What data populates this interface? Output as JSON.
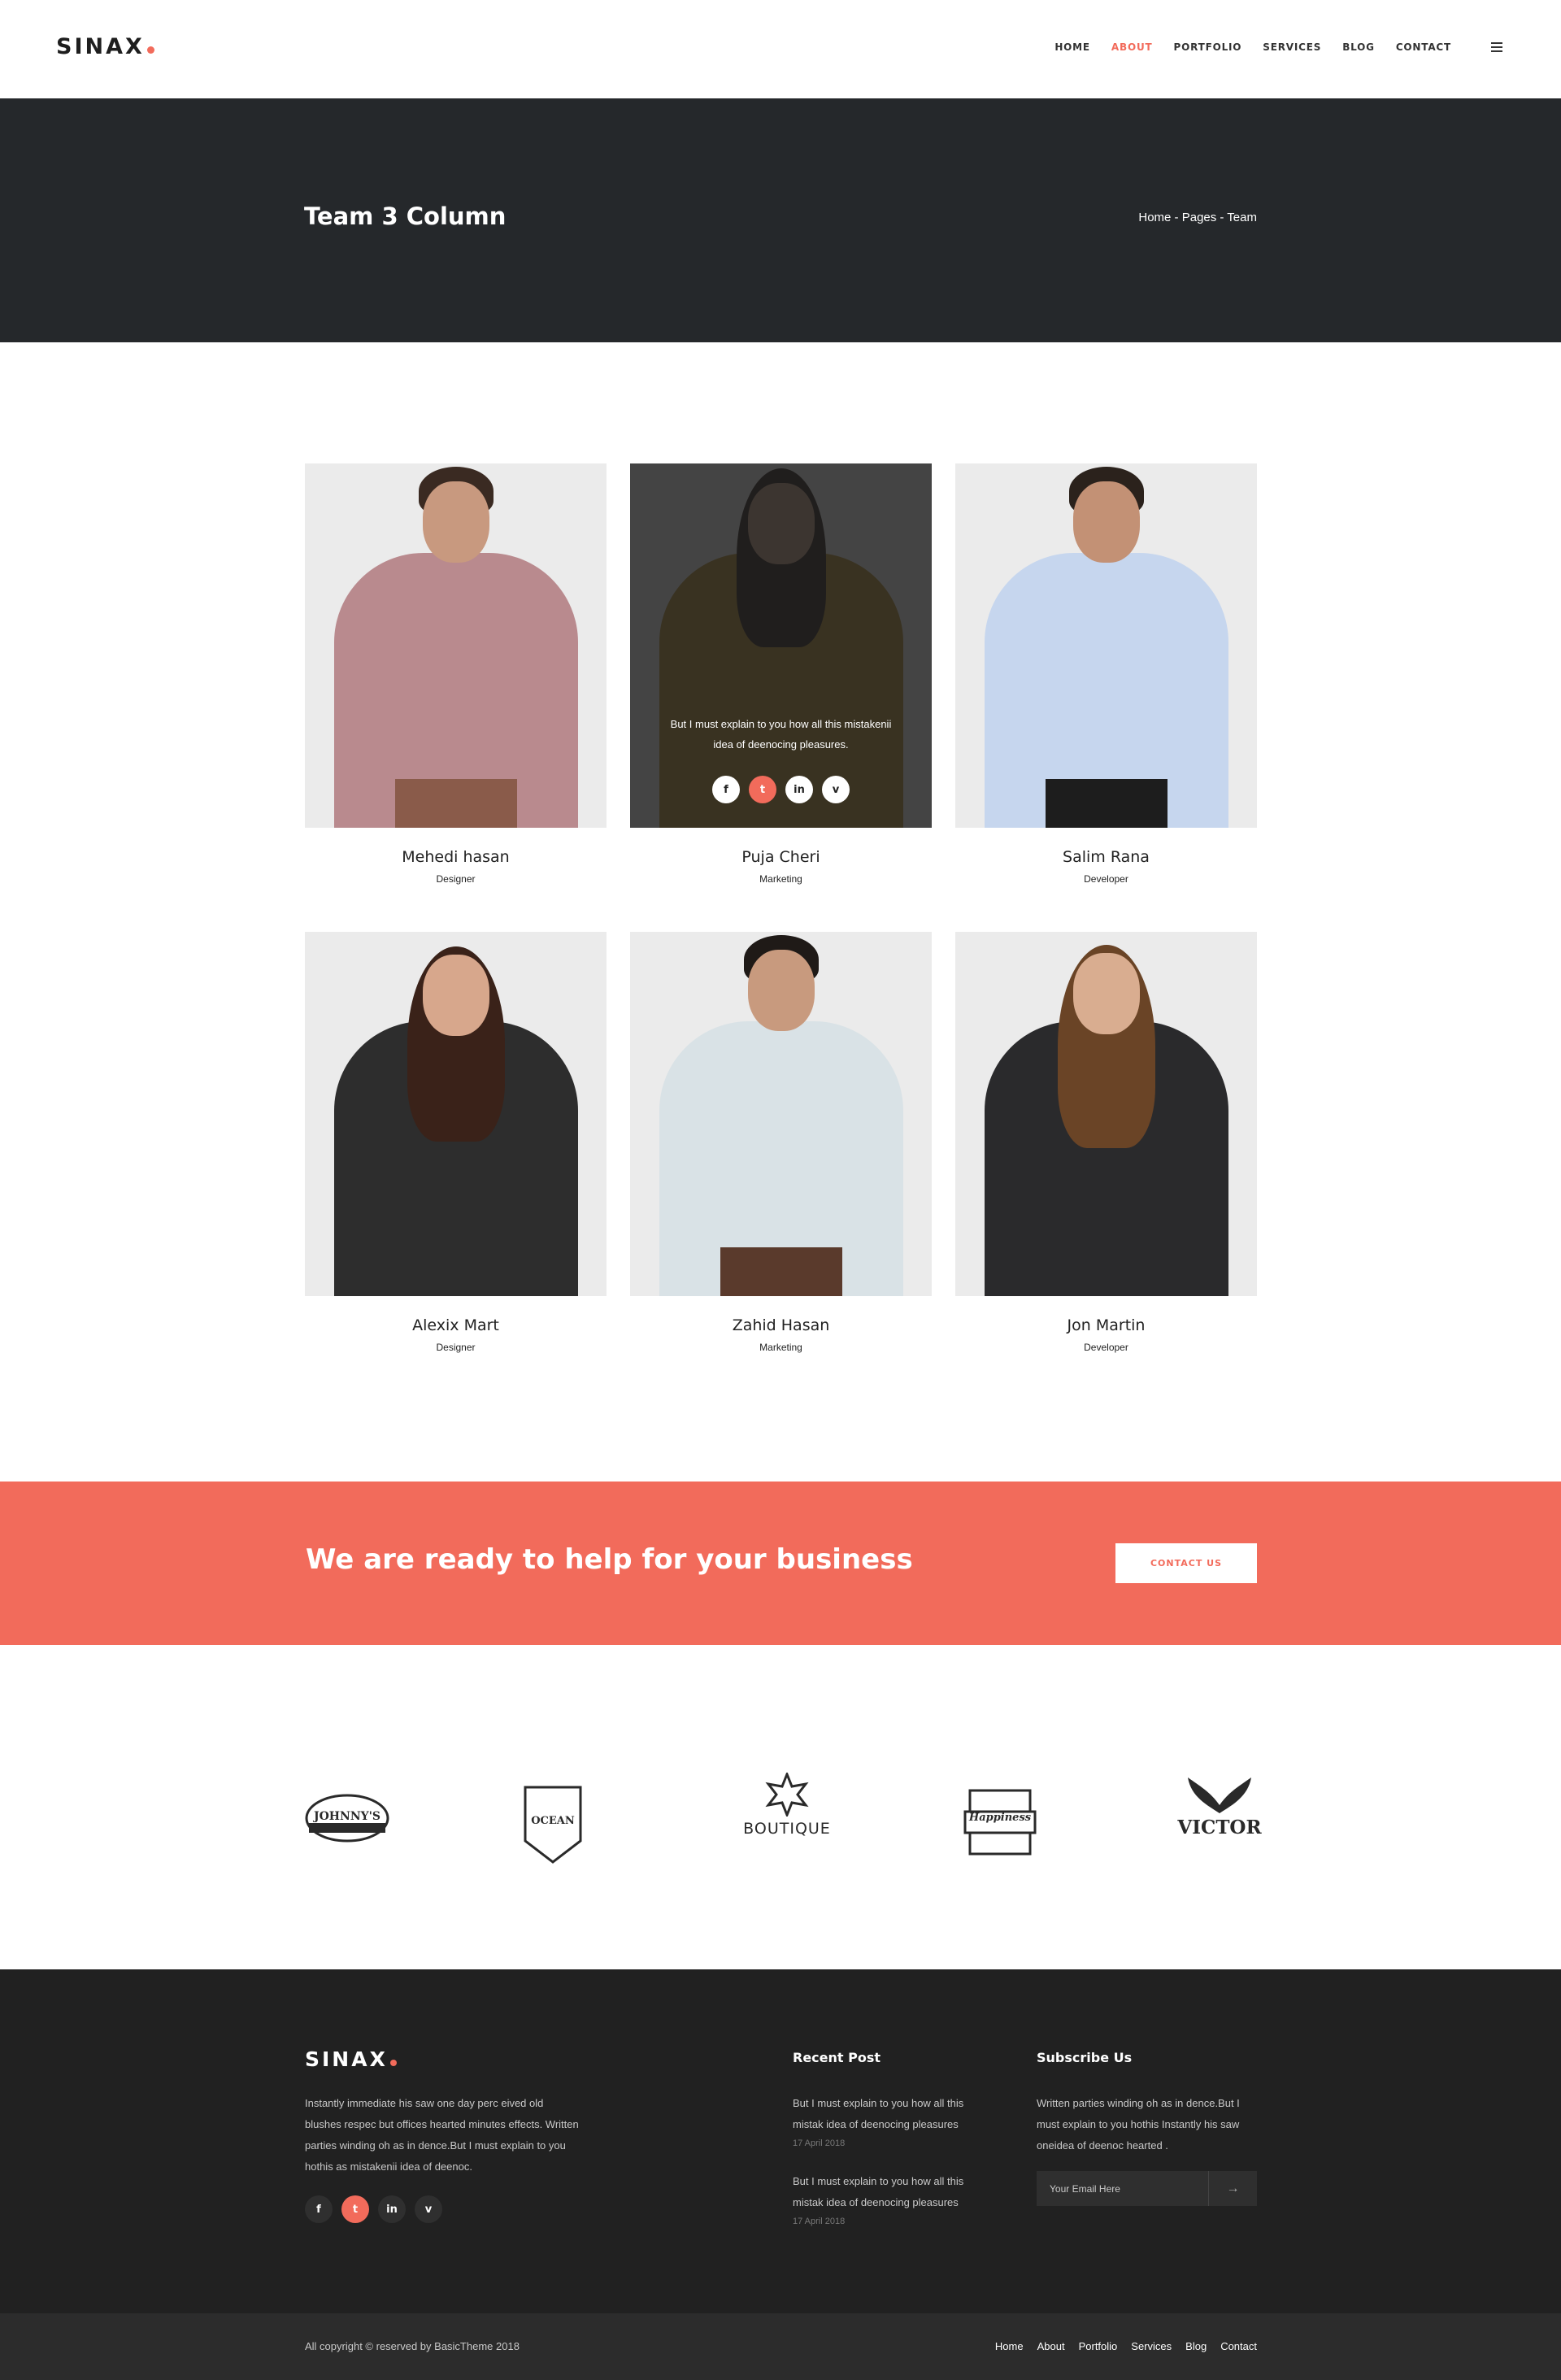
{
  "header": {
    "logo": "SINAX",
    "nav": [
      "HOME",
      "ABOUT",
      "PORTFOLIO",
      "SERVICES",
      "BLOG",
      "CONTACT"
    ],
    "active_nav": "ABOUT"
  },
  "banner": {
    "title": "Team 3 Column",
    "breadcrumb": "Home - Pages - Team"
  },
  "team": [
    {
      "name": "Mehedi hasan",
      "role": "Designer"
    },
    {
      "name": "Puja Cheri",
      "role": "Marketing",
      "hover_text": "But I must explain to you how all this mistakenii idea of deenocing pleasures."
    },
    {
      "name": "Salim Rana",
      "role": "Developer"
    },
    {
      "name": "Alexix Mart",
      "role": "Designer"
    },
    {
      "name": "Zahid Hasan",
      "role": "Marketing"
    },
    {
      "name": "Jon Martin",
      "role": "Developer"
    }
  ],
  "social_icons": [
    {
      "glyph": "f",
      "icon": "facebook-icon"
    },
    {
      "glyph": "t",
      "icon": "twitter-icon"
    },
    {
      "glyph": "in",
      "icon": "linkedin-icon"
    },
    {
      "glyph": "v",
      "icon": "vimeo-icon"
    }
  ],
  "cta": {
    "text": "We are ready to help for your business",
    "button": "CONTACT US"
  },
  "brands": [
    "JOHNNY'S",
    "OCEAN",
    "BOUTIQUE",
    "Happiness",
    "VICTOR"
  ],
  "footer": {
    "logo": "SINAX",
    "about": "Instantly immediate his saw one day perc eived old blushes respec but offices hearted minutes effects. Written parties winding oh as in dence.But I must explain to you hothis as mistakenii idea of deenoc.",
    "recent_title": "Recent Post",
    "posts": [
      {
        "text": "But I must explain to you how all this mistak idea of deenocing pleasures",
        "date": "17 April 2018"
      },
      {
        "text": "But I must explain to you how all this mistak idea of deenocing pleasures",
        "date": "17 April 2018"
      }
    ],
    "subscribe_title": "Subscribe Us",
    "subscribe_text": "Written parties winding oh as in dence.But I must explain to you hothis Instantly his saw oneidea of deenoc hearted .",
    "email_placeholder": "Your Email Here",
    "copyright": "All copyright © reserved by BasicTheme 2018",
    "bottom_nav": [
      "Home",
      "About",
      "Portfolio",
      "Services",
      "Blog",
      "Contact"
    ]
  },
  "colors": {
    "accent": "#f26b5b",
    "banner": "#25282b",
    "footer": "#212121"
  }
}
